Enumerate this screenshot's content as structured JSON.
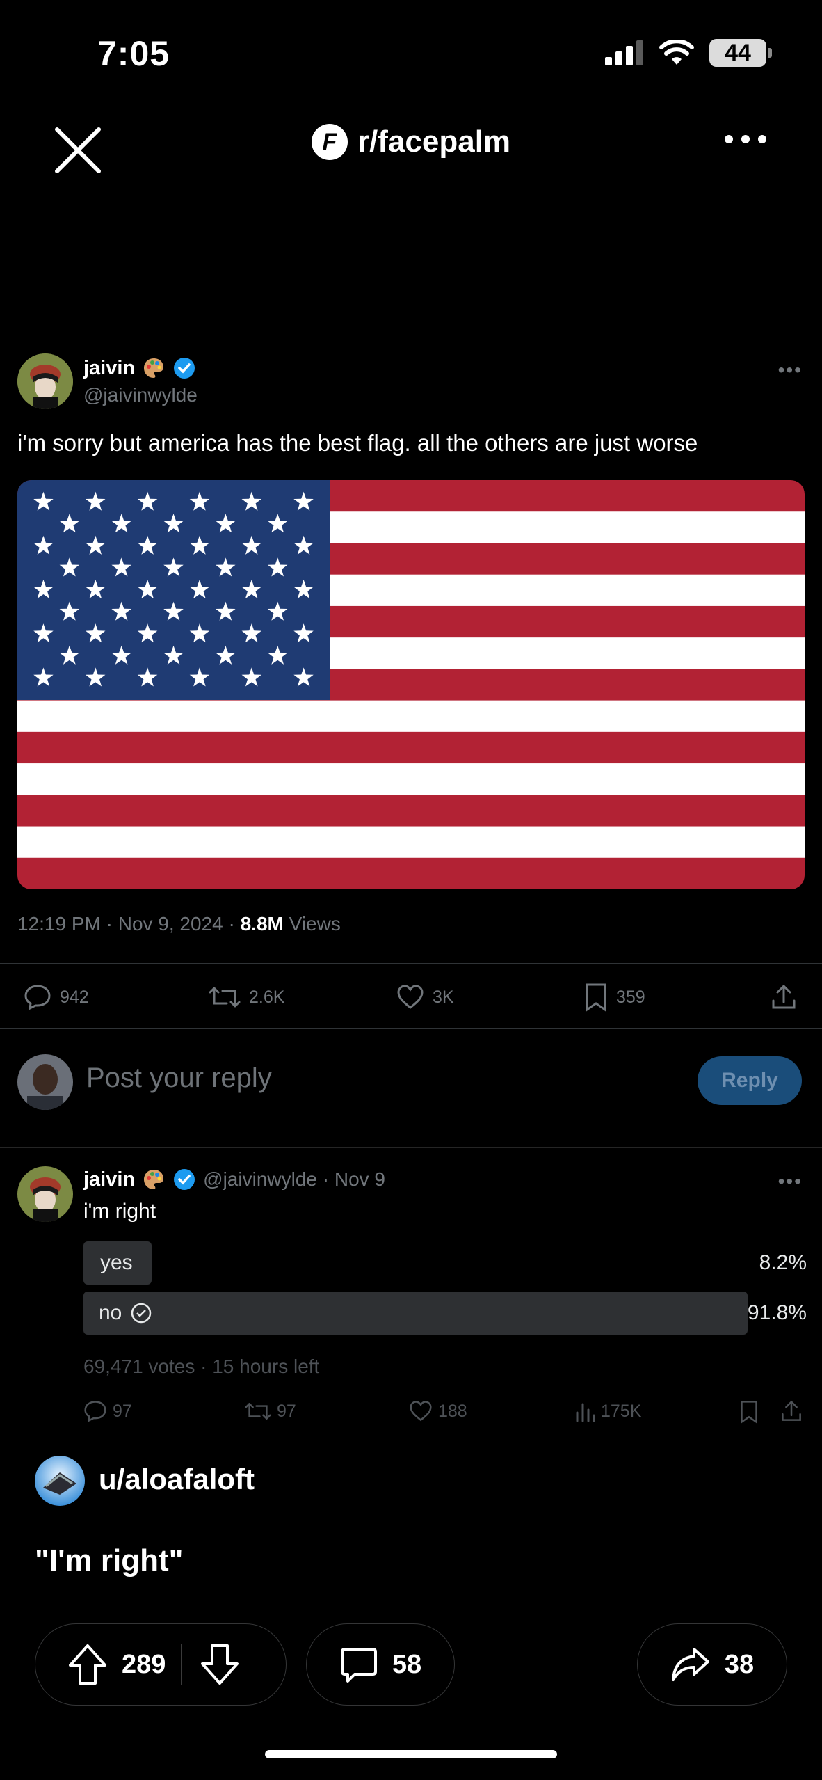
{
  "status_bar": {
    "time": "7:05",
    "battery": "44"
  },
  "header": {
    "subreddit": "r/facepalm",
    "subreddit_icon_letter": "F"
  },
  "tweet": {
    "author_name": "jaivin",
    "author_handle": "@jaivinwylde",
    "text": "i'm sorry but america has the best flag. all the others are just worse",
    "time": "12:19 PM · Nov 9, 2024 · ",
    "views_count": "8.8M",
    "views_label": " Views",
    "stats": {
      "replies": "942",
      "reposts": "2.6K",
      "likes": "3K",
      "bookmarks": "359"
    },
    "reply_placeholder": "Post your reply",
    "reply_button": "Reply"
  },
  "reply_tweet": {
    "author_name": "jaivin",
    "meta": "@jaivinwylde · Nov 9",
    "text": "i'm right",
    "poll": {
      "options": [
        {
          "label": "yes",
          "percent": "8.2%",
          "fraction": 0.082
        },
        {
          "label": "no",
          "percent": "91.8%",
          "fraction": 0.918,
          "selected": true
        }
      ],
      "summary": "69,471 votes · 15 hours left"
    },
    "stats": {
      "replies": "97",
      "reposts": "97",
      "likes": "188",
      "views": "175K"
    }
  },
  "reddit_post": {
    "username": "u/aloafaloft",
    "title": "\"I'm right\"",
    "upvotes": "289",
    "comments": "58",
    "shares": "38"
  },
  "colors": {
    "background": "#000000",
    "verified": "#1d9bf0",
    "flag_red": "#b22234",
    "flag_blue": "#1f3b73"
  }
}
